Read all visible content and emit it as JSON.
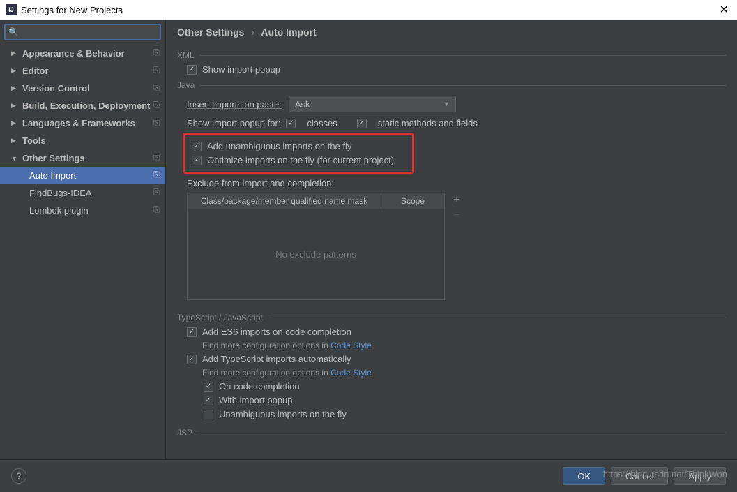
{
  "window": {
    "title": "Settings for New Projects"
  },
  "search": {
    "placeholder": ""
  },
  "sidebar": {
    "items": [
      {
        "label": "Appearance & Behavior",
        "expanded": false,
        "reset": true
      },
      {
        "label": "Editor",
        "expanded": false,
        "reset": true
      },
      {
        "label": "Version Control",
        "expanded": false,
        "reset": true
      },
      {
        "label": "Build, Execution, Deployment",
        "expanded": false,
        "reset": true
      },
      {
        "label": "Languages & Frameworks",
        "expanded": false,
        "reset": true
      },
      {
        "label": "Tools",
        "expanded": false,
        "reset": false
      },
      {
        "label": "Other Settings",
        "expanded": true,
        "reset": true
      }
    ],
    "subitems": [
      {
        "label": "Auto Import",
        "selected": true,
        "reset": true
      },
      {
        "label": "FindBugs-IDEA",
        "selected": false,
        "reset": true
      },
      {
        "label": "Lombok plugin",
        "selected": false,
        "reset": true
      }
    ]
  },
  "breadcrumb": {
    "parent": "Other Settings",
    "child": "Auto Import"
  },
  "sections": {
    "xml": {
      "title": "XML",
      "show_import_popup": "Show import popup"
    },
    "java": {
      "title": "Java",
      "insert_label": "Insert imports on paste:",
      "insert_value": "Ask",
      "popup_label": "Show import popup for:",
      "popup_classes": "classes",
      "popup_static": "static methods and fields",
      "add_unambiguous": "Add unambiguous imports on the fly",
      "optimize": "Optimize imports on the fly (for current project)",
      "exclude_label": "Exclude from import and completion:",
      "table_header_name": "Class/package/member qualified name mask",
      "table_header_scope": "Scope",
      "table_empty": "No exclude patterns"
    },
    "ts": {
      "title": "TypeScript / JavaScript",
      "add_es6": "Add ES6 imports on code completion",
      "hint_prefix": "Find more configuration options in ",
      "hint_link": "Code Style",
      "add_ts": "Add TypeScript imports automatically",
      "on_completion": "On code completion",
      "with_popup": "With import popup",
      "unambiguous": "Unambiguous imports on the fly"
    },
    "jsp": {
      "title": "JSP"
    }
  },
  "footer": {
    "ok": "OK",
    "cancel": "Cancel",
    "apply": "Apply"
  },
  "watermark": "https://blog.csdn.net/ThinkWon"
}
